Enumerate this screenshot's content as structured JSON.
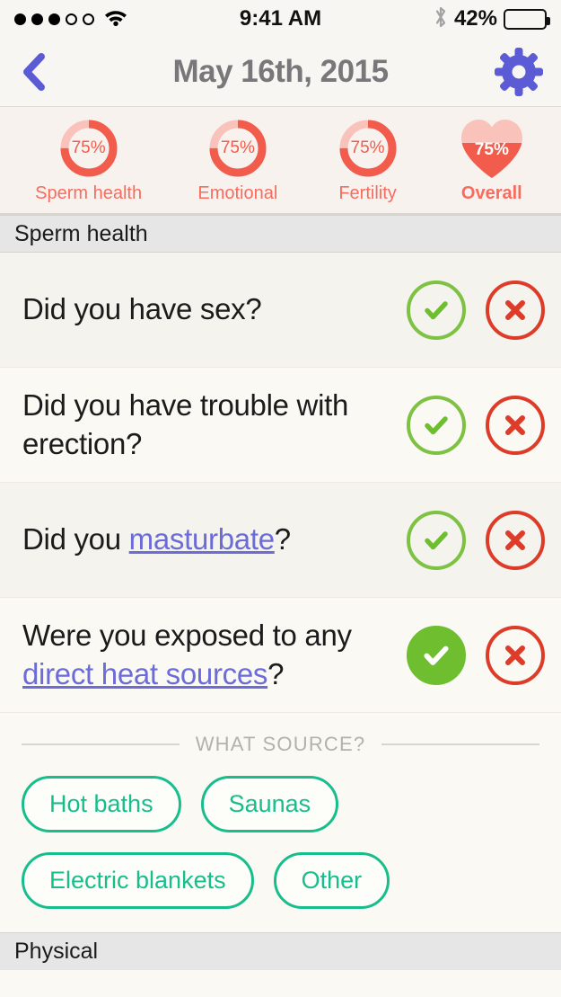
{
  "status_bar": {
    "signal_filled": 3,
    "signal_total": 5,
    "wifi_icon": "wifi-icon",
    "time": "9:41 AM",
    "bluetooth_icon": "bluetooth-icon",
    "battery_percent_label": "42%",
    "battery_level": 42
  },
  "nav": {
    "back_icon": "chevron-left-icon",
    "title": "May 16th, 2015",
    "settings_icon": "gear-icon"
  },
  "metrics": {
    "items": [
      {
        "label": "Sperm health",
        "value_label": "75%",
        "value": 75,
        "shape": "ring",
        "bold": false
      },
      {
        "label": "Emotional",
        "value_label": "75%",
        "value": 75,
        "shape": "ring",
        "bold": false
      },
      {
        "label": "Fertility",
        "value_label": "75%",
        "value": 75,
        "shape": "ring",
        "bold": false
      },
      {
        "label": "Overall",
        "value_label": "75%",
        "value": 75,
        "shape": "heart",
        "bold": true
      }
    ]
  },
  "sections": [
    {
      "title": "Sperm health"
    },
    {
      "title": "Physical"
    }
  ],
  "questions": [
    {
      "text_before": "Did you have sex?",
      "link": "",
      "text_after": "",
      "yes_icon": "check-icon",
      "no_icon": "cross-icon",
      "selected": "none"
    },
    {
      "text_before": "Did you have trouble with erection?",
      "link": "",
      "text_after": "",
      "yes_icon": "check-icon",
      "no_icon": "cross-icon",
      "selected": "none"
    },
    {
      "text_before": "Did you ",
      "link": "masturbate",
      "text_after": "?",
      "yes_icon": "check-icon",
      "no_icon": "cross-icon",
      "selected": "none"
    },
    {
      "text_before": "Were you exposed to any ",
      "link": "direct heat sources",
      "text_after": "?",
      "yes_icon": "check-icon",
      "no_icon": "cross-icon",
      "selected": "yes"
    }
  ],
  "source_picker": {
    "divider_label": "WHAT SOURCE?",
    "chips": [
      "Hot baths",
      "Saunas",
      "Electric blankets",
      "Other"
    ]
  },
  "colors": {
    "coral": "#F25C4D",
    "coral_light": "#F9C3BB",
    "link_blue": "#6C6CD8",
    "accent_periwinkle": "#5B5BD6",
    "green": "#7DC242",
    "green_filled": "#6FBE2F",
    "red": "#DC3C28",
    "chip_green": "#17BE8B",
    "section_header_bg": "#E6E6E6"
  }
}
